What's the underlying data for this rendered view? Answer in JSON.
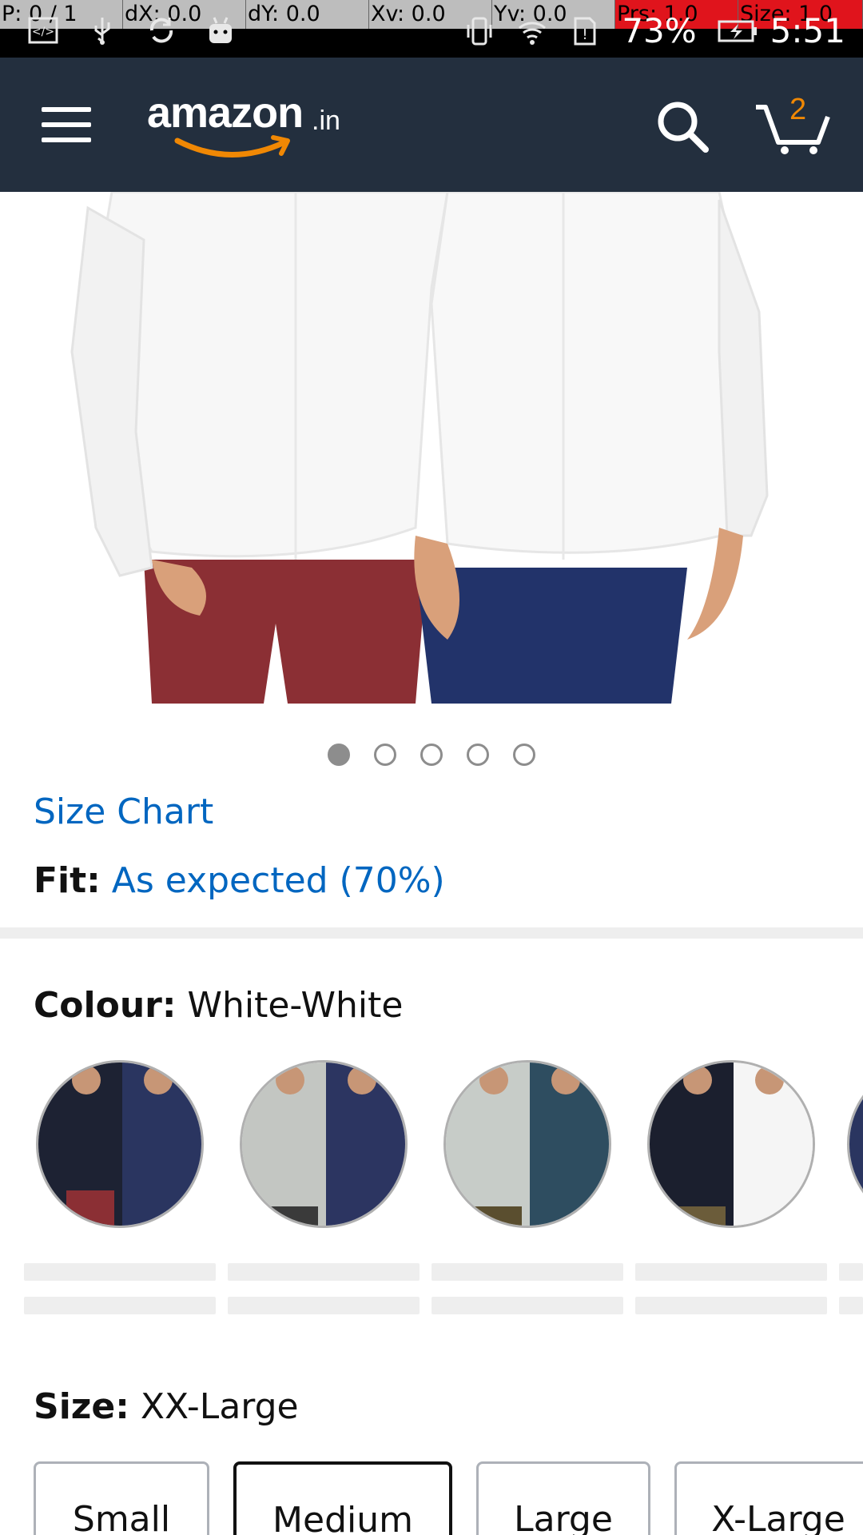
{
  "status_bar": {
    "debug": {
      "pointer": "P: 0 / 1",
      "dx": "dX: 0.0",
      "dy": "dY: 0.0",
      "xv": "Xv: 0.0",
      "yv": "Yv: 0.0",
      "prs": "Prs: 1.0",
      "size": "Size: 1.0"
    },
    "battery": "73%",
    "time": "5:51"
  },
  "header": {
    "logo_text": "amazon",
    "logo_suffix": ".in",
    "cart_count": "2",
    "colors": {
      "background": "#232f3e",
      "accent": "#f08804"
    }
  },
  "carousel": {
    "count": 5,
    "active_index": 0
  },
  "product": {
    "size_chart_label": "Size Chart",
    "fit_label": "Fit:",
    "fit_value": "As expected (70%)",
    "colour_label": "Colour:",
    "colour_value": "White-White",
    "size_label": "Size:",
    "size_value": "XX-Large"
  },
  "sizes": [
    {
      "label": "Small",
      "selected": false
    },
    {
      "label": "Medium",
      "selected": true
    },
    {
      "label": "Large",
      "selected": false
    },
    {
      "label": "X-Large",
      "selected": false
    }
  ],
  "link_color": "#0066c0"
}
